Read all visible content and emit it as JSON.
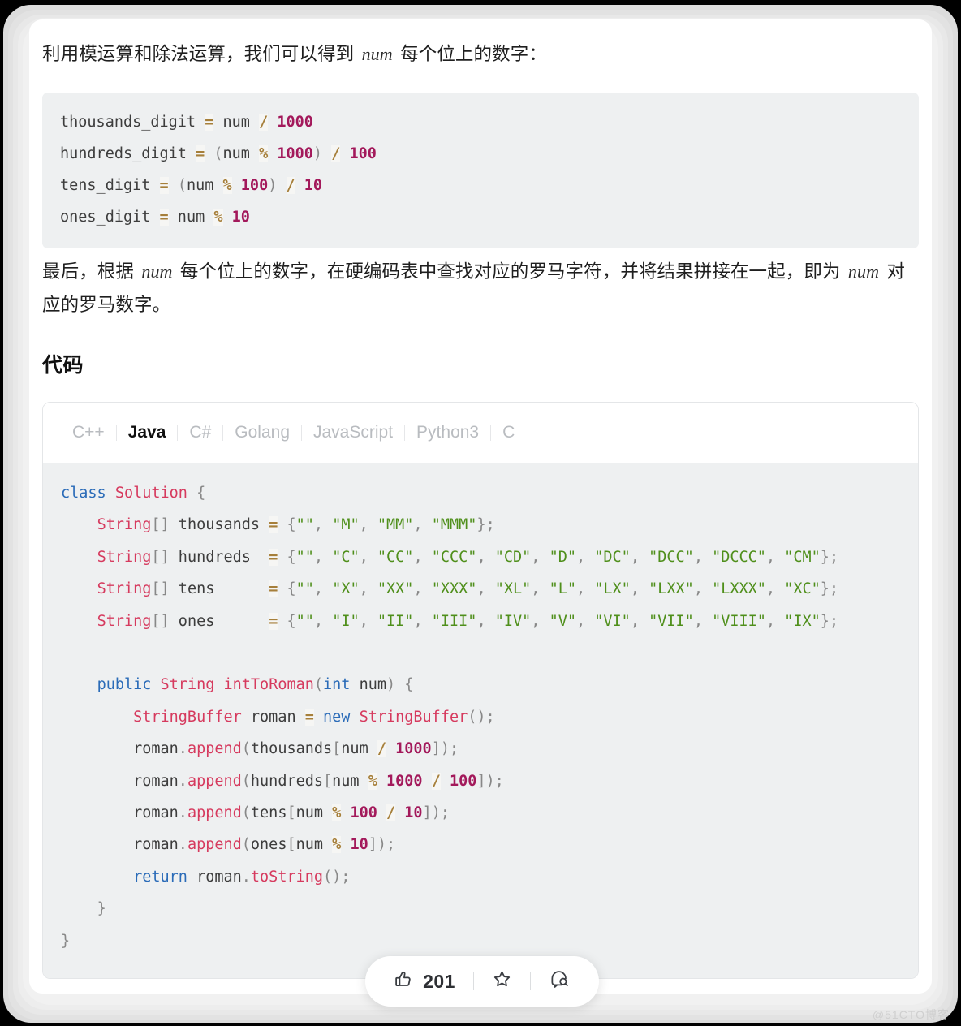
{
  "paragraphs": {
    "intro_before": "利用模运算和除法运算，我们可以得到 ",
    "intro_var": "num",
    "intro_after": " 每个位上的数字：",
    "conclusion_before": "最后，根据 ",
    "conclusion_var1": "num",
    "conclusion_mid": " 每个位上的数字，在硬编码表中查找对应的罗马字符，并将结果拼接在一起，即为 ",
    "conclusion_var2": "num",
    "conclusion_after": " 对应的罗马数字。"
  },
  "pseudo_code": {
    "lines": [
      [
        {
          "t": "thousands_digit ",
          "c": "tok-id"
        },
        {
          "t": "=",
          "c": "tok-op"
        },
        {
          "t": " num ",
          "c": "tok-id"
        },
        {
          "t": "/",
          "c": "tok-op"
        },
        {
          "t": " ",
          "c": "tok-id"
        },
        {
          "t": "1000",
          "c": "tok-num"
        }
      ],
      [
        {
          "t": "hundreds_digit ",
          "c": "tok-id"
        },
        {
          "t": "=",
          "c": "tok-op"
        },
        {
          "t": " ",
          "c": "tok-id"
        },
        {
          "t": "(",
          "c": "tok-punc"
        },
        {
          "t": "num ",
          "c": "tok-id"
        },
        {
          "t": "%",
          "c": "tok-op"
        },
        {
          "t": " ",
          "c": "tok-id"
        },
        {
          "t": "1000",
          "c": "tok-num"
        },
        {
          "t": ")",
          "c": "tok-punc"
        },
        {
          "t": " ",
          "c": "tok-id"
        },
        {
          "t": "/",
          "c": "tok-op"
        },
        {
          "t": " ",
          "c": "tok-id"
        },
        {
          "t": "100",
          "c": "tok-num"
        }
      ],
      [
        {
          "t": "tens_digit ",
          "c": "tok-id"
        },
        {
          "t": "=",
          "c": "tok-op"
        },
        {
          "t": " ",
          "c": "tok-id"
        },
        {
          "t": "(",
          "c": "tok-punc"
        },
        {
          "t": "num ",
          "c": "tok-id"
        },
        {
          "t": "%",
          "c": "tok-op"
        },
        {
          "t": " ",
          "c": "tok-id"
        },
        {
          "t": "100",
          "c": "tok-num"
        },
        {
          "t": ")",
          "c": "tok-punc"
        },
        {
          "t": " ",
          "c": "tok-id"
        },
        {
          "t": "/",
          "c": "tok-op"
        },
        {
          "t": " ",
          "c": "tok-id"
        },
        {
          "t": "10",
          "c": "tok-num"
        }
      ],
      [
        {
          "t": "ones_digit ",
          "c": "tok-id"
        },
        {
          "t": "=",
          "c": "tok-op"
        },
        {
          "t": " num ",
          "c": "tok-id"
        },
        {
          "t": "%",
          "c": "tok-op"
        },
        {
          "t": " ",
          "c": "tok-id"
        },
        {
          "t": "10",
          "c": "tok-num"
        }
      ]
    ]
  },
  "section": {
    "code_heading": "代码"
  },
  "code_card": {
    "tabs": [
      {
        "label": "C++",
        "active": false
      },
      {
        "label": "Java",
        "active": true
      },
      {
        "label": "C#",
        "active": false
      },
      {
        "label": "Golang",
        "active": false
      },
      {
        "label": "JavaScript",
        "active": false
      },
      {
        "label": "Python3",
        "active": false
      },
      {
        "label": "C",
        "active": false
      }
    ],
    "language": "Java",
    "source_plain": "class Solution {\n    String[] thousands = {\"\", \"M\", \"MM\", \"MMM\"};\n    String[] hundreds  = {\"\", \"C\", \"CC\", \"CCC\", \"CD\", \"D\", \"DC\", \"DCC\", \"DCCC\", \"CM\"};\n    String[] tens      = {\"\", \"X\", \"XX\", \"XXX\", \"XL\", \"L\", \"LX\", \"LXX\", \"LXXX\", \"XC\"};\n    String[] ones      = {\"\", \"I\", \"II\", \"III\", \"IV\", \"V\", \"VI\", \"VII\", \"VIII\", \"IX\"};\n\n    public String intToRoman(int num) {\n        StringBuffer roman = new StringBuffer();\n        roman.append(thousands[num / 1000]);\n        roman.append(hundreds[num % 1000 / 100]);\n        roman.append(tens[num % 100 / 10]);\n        roman.append(ones[num % 10]);\n        return roman.toString();\n    }\n}",
    "lines": [
      [
        {
          "t": "class",
          "c": "tok-kw"
        },
        {
          "t": " ",
          "c": "tok-id"
        },
        {
          "t": "Solution",
          "c": "tok-type"
        },
        {
          "t": " ",
          "c": "tok-id"
        },
        {
          "t": "{",
          "c": "tok-punc"
        }
      ],
      [
        {
          "t": "    ",
          "c": "tok-id"
        },
        {
          "t": "String",
          "c": "tok-type"
        },
        {
          "t": "[]",
          "c": "tok-punc"
        },
        {
          "t": " thousands ",
          "c": "tok-id"
        },
        {
          "t": "=",
          "c": "tok-op"
        },
        {
          "t": " ",
          "c": "tok-id"
        },
        {
          "t": "{",
          "c": "tok-punc"
        },
        {
          "t": "\"\"",
          "c": "tok-str"
        },
        {
          "t": ", ",
          "c": "tok-punc"
        },
        {
          "t": "\"M\"",
          "c": "tok-str"
        },
        {
          "t": ", ",
          "c": "tok-punc"
        },
        {
          "t": "\"MM\"",
          "c": "tok-str"
        },
        {
          "t": ", ",
          "c": "tok-punc"
        },
        {
          "t": "\"MMM\"",
          "c": "tok-str"
        },
        {
          "t": "};",
          "c": "tok-punc"
        }
      ],
      [
        {
          "t": "    ",
          "c": "tok-id"
        },
        {
          "t": "String",
          "c": "tok-type"
        },
        {
          "t": "[]",
          "c": "tok-punc"
        },
        {
          "t": " hundreds  ",
          "c": "tok-id"
        },
        {
          "t": "=",
          "c": "tok-op"
        },
        {
          "t": " ",
          "c": "tok-id"
        },
        {
          "t": "{",
          "c": "tok-punc"
        },
        {
          "t": "\"\"",
          "c": "tok-str"
        },
        {
          "t": ", ",
          "c": "tok-punc"
        },
        {
          "t": "\"C\"",
          "c": "tok-str"
        },
        {
          "t": ", ",
          "c": "tok-punc"
        },
        {
          "t": "\"CC\"",
          "c": "tok-str"
        },
        {
          "t": ", ",
          "c": "tok-punc"
        },
        {
          "t": "\"CCC\"",
          "c": "tok-str"
        },
        {
          "t": ", ",
          "c": "tok-punc"
        },
        {
          "t": "\"CD\"",
          "c": "tok-str"
        },
        {
          "t": ", ",
          "c": "tok-punc"
        },
        {
          "t": "\"D\"",
          "c": "tok-str"
        },
        {
          "t": ", ",
          "c": "tok-punc"
        },
        {
          "t": "\"DC\"",
          "c": "tok-str"
        },
        {
          "t": ", ",
          "c": "tok-punc"
        },
        {
          "t": "\"DCC\"",
          "c": "tok-str"
        },
        {
          "t": ", ",
          "c": "tok-punc"
        },
        {
          "t": "\"DCCC\"",
          "c": "tok-str"
        },
        {
          "t": ", ",
          "c": "tok-punc"
        },
        {
          "t": "\"CM\"",
          "c": "tok-str"
        },
        {
          "t": "};",
          "c": "tok-punc"
        }
      ],
      [
        {
          "t": "    ",
          "c": "tok-id"
        },
        {
          "t": "String",
          "c": "tok-type"
        },
        {
          "t": "[]",
          "c": "tok-punc"
        },
        {
          "t": " tens      ",
          "c": "tok-id"
        },
        {
          "t": "=",
          "c": "tok-op"
        },
        {
          "t": " ",
          "c": "tok-id"
        },
        {
          "t": "{",
          "c": "tok-punc"
        },
        {
          "t": "\"\"",
          "c": "tok-str"
        },
        {
          "t": ", ",
          "c": "tok-punc"
        },
        {
          "t": "\"X\"",
          "c": "tok-str"
        },
        {
          "t": ", ",
          "c": "tok-punc"
        },
        {
          "t": "\"XX\"",
          "c": "tok-str"
        },
        {
          "t": ", ",
          "c": "tok-punc"
        },
        {
          "t": "\"XXX\"",
          "c": "tok-str"
        },
        {
          "t": ", ",
          "c": "tok-punc"
        },
        {
          "t": "\"XL\"",
          "c": "tok-str"
        },
        {
          "t": ", ",
          "c": "tok-punc"
        },
        {
          "t": "\"L\"",
          "c": "tok-str"
        },
        {
          "t": ", ",
          "c": "tok-punc"
        },
        {
          "t": "\"LX\"",
          "c": "tok-str"
        },
        {
          "t": ", ",
          "c": "tok-punc"
        },
        {
          "t": "\"LXX\"",
          "c": "tok-str"
        },
        {
          "t": ", ",
          "c": "tok-punc"
        },
        {
          "t": "\"LXXX\"",
          "c": "tok-str"
        },
        {
          "t": ", ",
          "c": "tok-punc"
        },
        {
          "t": "\"XC\"",
          "c": "tok-str"
        },
        {
          "t": "};",
          "c": "tok-punc"
        }
      ],
      [
        {
          "t": "    ",
          "c": "tok-id"
        },
        {
          "t": "String",
          "c": "tok-type"
        },
        {
          "t": "[]",
          "c": "tok-punc"
        },
        {
          "t": " ones      ",
          "c": "tok-id"
        },
        {
          "t": "=",
          "c": "tok-op"
        },
        {
          "t": " ",
          "c": "tok-id"
        },
        {
          "t": "{",
          "c": "tok-punc"
        },
        {
          "t": "\"\"",
          "c": "tok-str"
        },
        {
          "t": ", ",
          "c": "tok-punc"
        },
        {
          "t": "\"I\"",
          "c": "tok-str"
        },
        {
          "t": ", ",
          "c": "tok-punc"
        },
        {
          "t": "\"II\"",
          "c": "tok-str"
        },
        {
          "t": ", ",
          "c": "tok-punc"
        },
        {
          "t": "\"III\"",
          "c": "tok-str"
        },
        {
          "t": ", ",
          "c": "tok-punc"
        },
        {
          "t": "\"IV\"",
          "c": "tok-str"
        },
        {
          "t": ", ",
          "c": "tok-punc"
        },
        {
          "t": "\"V\"",
          "c": "tok-str"
        },
        {
          "t": ", ",
          "c": "tok-punc"
        },
        {
          "t": "\"VI\"",
          "c": "tok-str"
        },
        {
          "t": ", ",
          "c": "tok-punc"
        },
        {
          "t": "\"VII\"",
          "c": "tok-str"
        },
        {
          "t": ", ",
          "c": "tok-punc"
        },
        {
          "t": "\"VIII\"",
          "c": "tok-str"
        },
        {
          "t": ", ",
          "c": "tok-punc"
        },
        {
          "t": "\"IX\"",
          "c": "tok-str"
        },
        {
          "t": "};",
          "c": "tok-punc"
        }
      ],
      [
        {
          "t": " ",
          "c": "tok-id"
        }
      ],
      [
        {
          "t": "    ",
          "c": "tok-id"
        },
        {
          "t": "public",
          "c": "tok-kw"
        },
        {
          "t": " ",
          "c": "tok-id"
        },
        {
          "t": "String",
          "c": "tok-type"
        },
        {
          "t": " ",
          "c": "tok-id"
        },
        {
          "t": "intToRoman",
          "c": "tok-fn"
        },
        {
          "t": "(",
          "c": "tok-punc"
        },
        {
          "t": "int",
          "c": "tok-kw"
        },
        {
          "t": " num",
          "c": "tok-id"
        },
        {
          "t": ")",
          "c": "tok-punc"
        },
        {
          "t": " ",
          "c": "tok-id"
        },
        {
          "t": "{",
          "c": "tok-punc"
        }
      ],
      [
        {
          "t": "        ",
          "c": "tok-id"
        },
        {
          "t": "StringBuffer",
          "c": "tok-type"
        },
        {
          "t": " roman ",
          "c": "tok-id"
        },
        {
          "t": "=",
          "c": "tok-op"
        },
        {
          "t": " ",
          "c": "tok-id"
        },
        {
          "t": "new",
          "c": "tok-kw"
        },
        {
          "t": " ",
          "c": "tok-id"
        },
        {
          "t": "StringBuffer",
          "c": "tok-type"
        },
        {
          "t": "();",
          "c": "tok-punc"
        }
      ],
      [
        {
          "t": "        roman",
          "c": "tok-id"
        },
        {
          "t": ".",
          "c": "tok-punc"
        },
        {
          "t": "append",
          "c": "tok-fn"
        },
        {
          "t": "(",
          "c": "tok-punc"
        },
        {
          "t": "thousands",
          "c": "tok-id"
        },
        {
          "t": "[",
          "c": "tok-punc"
        },
        {
          "t": "num ",
          "c": "tok-id"
        },
        {
          "t": "/",
          "c": "tok-op"
        },
        {
          "t": " ",
          "c": "tok-id"
        },
        {
          "t": "1000",
          "c": "tok-num"
        },
        {
          "t": "]);",
          "c": "tok-punc"
        }
      ],
      [
        {
          "t": "        roman",
          "c": "tok-id"
        },
        {
          "t": ".",
          "c": "tok-punc"
        },
        {
          "t": "append",
          "c": "tok-fn"
        },
        {
          "t": "(",
          "c": "tok-punc"
        },
        {
          "t": "hundreds",
          "c": "tok-id"
        },
        {
          "t": "[",
          "c": "tok-punc"
        },
        {
          "t": "num ",
          "c": "tok-id"
        },
        {
          "t": "%",
          "c": "tok-op"
        },
        {
          "t": " ",
          "c": "tok-id"
        },
        {
          "t": "1000",
          "c": "tok-num"
        },
        {
          "t": " ",
          "c": "tok-id"
        },
        {
          "t": "/",
          "c": "tok-op"
        },
        {
          "t": " ",
          "c": "tok-id"
        },
        {
          "t": "100",
          "c": "tok-num"
        },
        {
          "t": "]);",
          "c": "tok-punc"
        }
      ],
      [
        {
          "t": "        roman",
          "c": "tok-id"
        },
        {
          "t": ".",
          "c": "tok-punc"
        },
        {
          "t": "append",
          "c": "tok-fn"
        },
        {
          "t": "(",
          "c": "tok-punc"
        },
        {
          "t": "tens",
          "c": "tok-id"
        },
        {
          "t": "[",
          "c": "tok-punc"
        },
        {
          "t": "num ",
          "c": "tok-id"
        },
        {
          "t": "%",
          "c": "tok-op"
        },
        {
          "t": " ",
          "c": "tok-id"
        },
        {
          "t": "100",
          "c": "tok-num"
        },
        {
          "t": " ",
          "c": "tok-id"
        },
        {
          "t": "/",
          "c": "tok-op"
        },
        {
          "t": " ",
          "c": "tok-id"
        },
        {
          "t": "10",
          "c": "tok-num"
        },
        {
          "t": "]);",
          "c": "tok-punc"
        }
      ],
      [
        {
          "t": "        roman",
          "c": "tok-id"
        },
        {
          "t": ".",
          "c": "tok-punc"
        },
        {
          "t": "append",
          "c": "tok-fn"
        },
        {
          "t": "(",
          "c": "tok-punc"
        },
        {
          "t": "ones",
          "c": "tok-id"
        },
        {
          "t": "[",
          "c": "tok-punc"
        },
        {
          "t": "num ",
          "c": "tok-id"
        },
        {
          "t": "%",
          "c": "tok-op"
        },
        {
          "t": " ",
          "c": "tok-id"
        },
        {
          "t": "10",
          "c": "tok-num"
        },
        {
          "t": "]);",
          "c": "tok-punc"
        }
      ],
      [
        {
          "t": "        ",
          "c": "tok-id"
        },
        {
          "t": "return",
          "c": "tok-kw"
        },
        {
          "t": " roman",
          "c": "tok-id"
        },
        {
          "t": ".",
          "c": "tok-punc"
        },
        {
          "t": "toString",
          "c": "tok-fn"
        },
        {
          "t": "();",
          "c": "tok-punc"
        }
      ],
      [
        {
          "t": "    ",
          "c": "tok-id"
        },
        {
          "t": "}",
          "c": "tok-punc"
        }
      ],
      [
        {
          "t": "}",
          "c": "tok-punc"
        }
      ]
    ]
  },
  "action_bar": {
    "like_icon": "thumbs-up-icon",
    "like_count": "201",
    "favorite_icon": "star-icon",
    "feedback_icon": "comment-search-icon"
  },
  "watermark": {
    "text": "@51CTO博客"
  },
  "colors": {
    "keyword": "#2a6bb8",
    "type": "#d63a5e",
    "string": "#4f8f1b",
    "number": "#a3195b",
    "operator": "#a67f3a",
    "punctuation": "#888888",
    "code_bg": "#eef0f1",
    "page_bg": "#ffffff",
    "tab_active": "#0f0f0f",
    "tab_inactive": "#b9bcc0"
  }
}
